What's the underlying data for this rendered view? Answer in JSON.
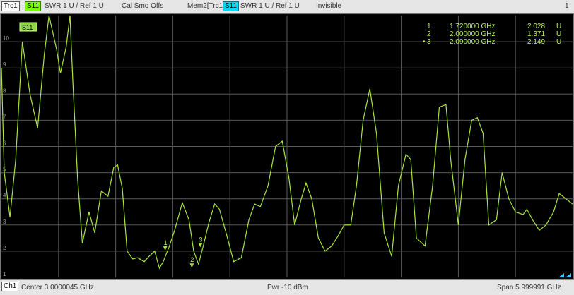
{
  "header": {
    "trace_tag": "Trc1",
    "param_tag": "S11",
    "format_info": "SWR  1 U /  Ref 1 U",
    "status_info": "Cal Smo Offs",
    "mem_tag": "Mem2[Trc1]",
    "mem_param_tag": "S11",
    "mem_format_info": "SWR  1 U /  Ref 1 U",
    "mem_state": "Invisible",
    "window_number": "1"
  },
  "footer": {
    "channel_tag": "Ch1",
    "center": "Center  3.0000045 GHz",
    "power": "Pwr  -10 dBm",
    "span": "Span  5.999991 GHz"
  },
  "colors": {
    "trace": "#a8e63c",
    "trace_tag": "#7cfc00",
    "mem_tag": "#00d8ff",
    "grid": "#5a5a5a"
  },
  "markers": [
    {
      "label": "1",
      "freq": "1.720000 GHz",
      "value": "2.028",
      "unit": "U",
      "active": false,
      "x_ghz": 1.72,
      "y": 2.028
    },
    {
      "label": "2",
      "freq": "2.000000 GHz",
      "value": "1.371",
      "unit": "U",
      "active": false,
      "x_ghz": 2.0,
      "y": 1.371
    },
    {
      "label": "3",
      "freq": "2.090000 GHz",
      "value": "2.149",
      "unit": "U",
      "active": true,
      "x_ghz": 2.09,
      "y": 2.149
    }
  ],
  "chart_data": {
    "type": "line",
    "trace_label": "S11",
    "x_range_ghz": [
      4.5e-06,
      6.0000035
    ],
    "ylim": [
      1,
      11
    ],
    "y_ticks": [
      "10",
      "9",
      "8",
      "7",
      "6",
      "5",
      "4",
      "3",
      "2",
      "1"
    ],
    "grid": true,
    "series": [
      {
        "x": [
          0.0,
          0.03,
          0.09,
          0.15,
          0.22,
          0.3,
          0.38,
          0.45,
          0.5,
          0.58,
          0.62,
          0.68,
          0.72,
          0.75,
          0.8,
          0.85,
          0.92,
          0.98,
          1.05,
          1.12,
          1.18,
          1.22,
          1.27,
          1.32,
          1.38,
          1.43,
          1.5,
          1.55,
          1.61,
          1.66,
          1.7,
          1.76,
          1.82,
          1.9,
          1.97,
          2.02,
          2.07,
          2.12,
          2.18,
          2.24,
          2.29,
          2.36,
          2.44,
          2.52,
          2.6,
          2.66,
          2.72,
          2.8,
          2.88,
          2.95,
          3.02,
          3.08,
          3.15,
          3.2,
          3.26,
          3.33,
          3.4,
          3.47,
          3.54,
          3.6,
          3.67,
          3.73,
          3.8,
          3.87,
          3.94,
          4.02,
          4.1,
          4.17,
          4.25,
          4.3,
          4.36,
          4.45,
          4.53,
          4.6,
          4.67,
          4.72,
          4.8,
          4.87,
          4.94,
          5.0,
          5.06,
          5.12,
          5.2,
          5.26,
          5.33,
          5.4,
          5.48,
          5.52,
          5.58,
          5.65,
          5.72,
          5.8,
          5.86,
          5.93,
          6.0
        ],
        "y": [
          9.0,
          5.0,
          3.3,
          5.5,
          10.0,
          8.0,
          6.7,
          9.5,
          11.0,
          9.7,
          8.8,
          9.8,
          11.0,
          8.5,
          4.8,
          2.3,
          3.5,
          2.7,
          4.3,
          4.1,
          5.2,
          5.3,
          4.4,
          2.0,
          1.7,
          1.75,
          1.6,
          1.8,
          2.0,
          1.35,
          1.6,
          2.15,
          2.8,
          3.85,
          3.2,
          2.0,
          1.5,
          2.2,
          3.1,
          3.8,
          3.6,
          2.7,
          1.6,
          1.75,
          3.2,
          3.8,
          3.7,
          4.5,
          6.0,
          6.2,
          4.8,
          3.0,
          4.0,
          4.6,
          4.0,
          2.5,
          2.0,
          2.2,
          2.6,
          3.0,
          3.0,
          4.5,
          7.0,
          8.2,
          6.5,
          2.7,
          1.8,
          4.5,
          5.7,
          5.5,
          2.5,
          2.2,
          4.5,
          7.5,
          7.6,
          5.5,
          3.0,
          5.5,
          7.0,
          7.1,
          6.5,
          3.0,
          3.2,
          5.0,
          4.0,
          3.5,
          3.4,
          3.6,
          3.2,
          2.8,
          3.0,
          3.5,
          4.2,
          4.0,
          3.8
        ]
      }
    ]
  }
}
